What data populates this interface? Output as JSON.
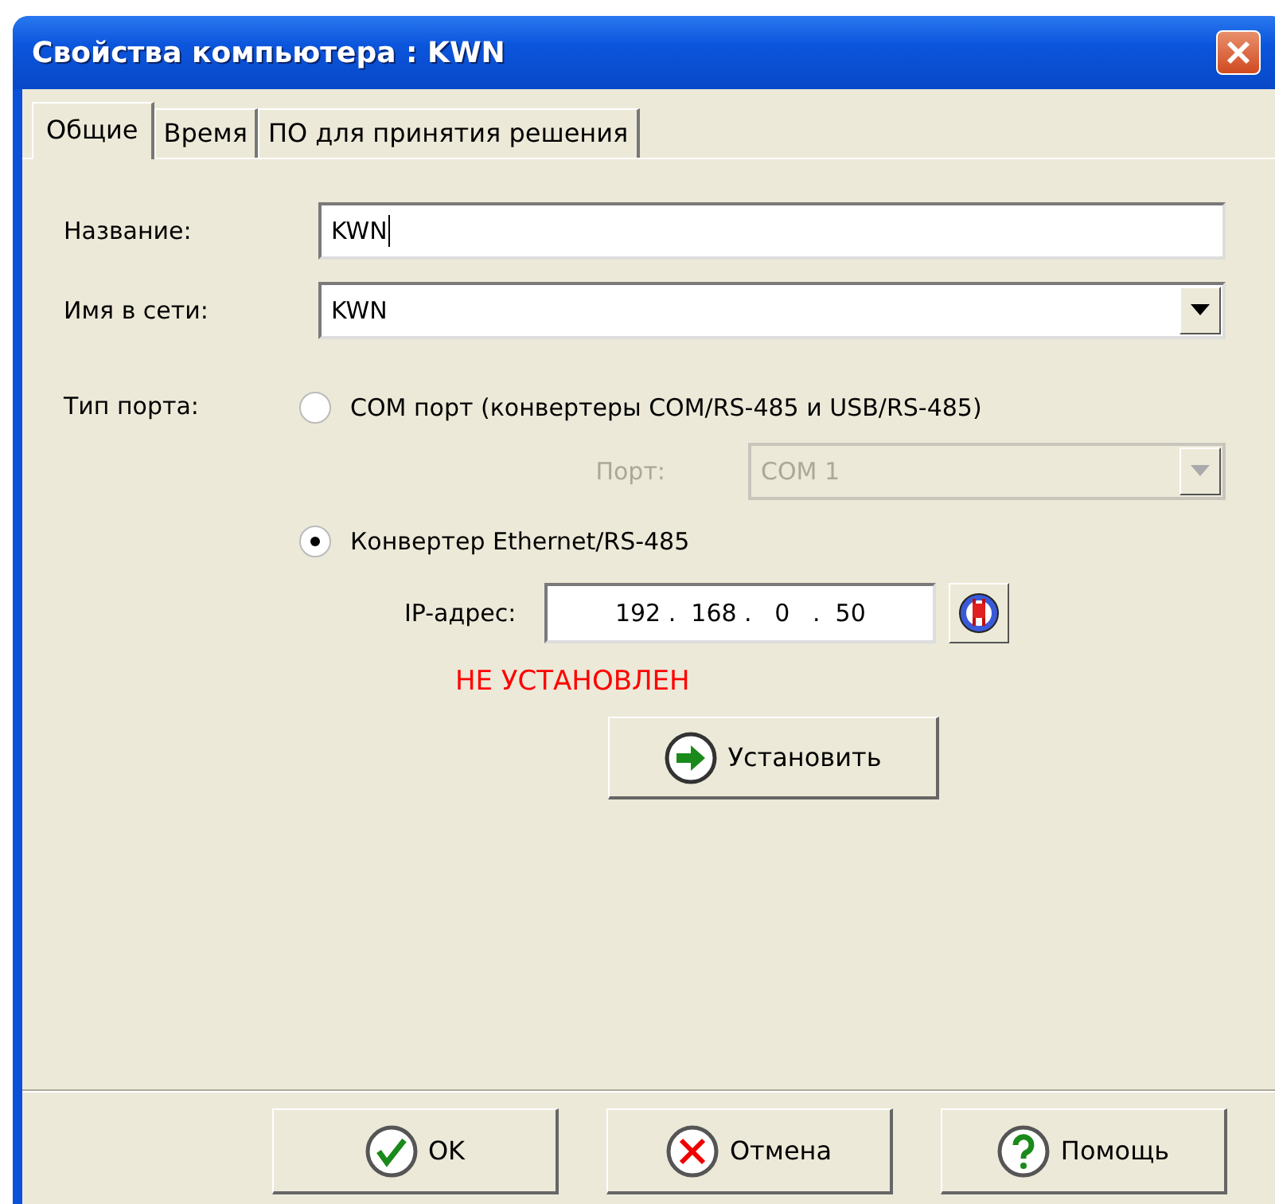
{
  "window": {
    "title": "Свойства компьютера : KWN"
  },
  "tabs": [
    {
      "label": "Общие",
      "selected": true
    },
    {
      "label": "Время",
      "selected": false
    },
    {
      "label": "ПО для принятия решения",
      "selected": false
    }
  ],
  "fields": [
    {
      "kind": "text",
      "label": "Название:",
      "value": "KWN",
      "focused": true
    },
    {
      "kind": "dropdown",
      "label": "Имя в сети:",
      "value": "KWN",
      "focused": false
    }
  ],
  "port_type": {
    "label": "Тип порта:",
    "options": [
      {
        "label": "COM порт (конвертеры COM/RS-485 и USB/RS-485)",
        "selected": false
      },
      {
        "label": "Конвертер Ethernet/RS-485",
        "selected": true
      }
    ]
  },
  "com_port": {
    "label": "Порт:",
    "value": "COM 1",
    "disabled": true
  },
  "ip": {
    "label": "IP-адрес:",
    "value": "192 .  168 .   0   .  50"
  },
  "status": {
    "text": "НЕ УСТАНОВЛЕН",
    "color": "#ff0000"
  },
  "install_button": {
    "label": "Установить"
  },
  "buttons": [
    {
      "kind": "ok",
      "label": "OK"
    },
    {
      "kind": "cancel",
      "label": "Отмена"
    },
    {
      "kind": "help",
      "label": "Помощь"
    }
  ]
}
